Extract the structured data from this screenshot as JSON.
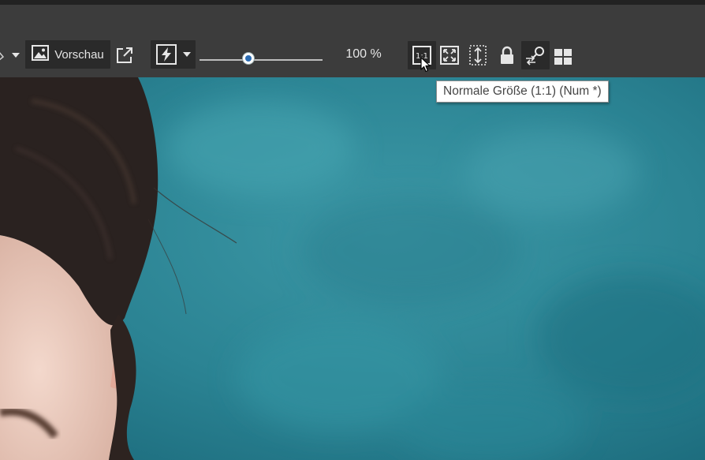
{
  "toolbar": {
    "preview_label": "Vorschau",
    "zoom_level": "100 %",
    "zoom_slider_value_percent": 40
  },
  "tooltip": {
    "text": "Normale Größe (1:1) (Num *)"
  },
  "icons": {
    "left_dropdown": "chevron-down-icon",
    "preview": "image-icon",
    "open_external": "external-link-icon",
    "quick_develop": "lightning-icon",
    "quick_develop_menu": "chevron-down-icon",
    "actual_size": "one-to-one-icon",
    "fit_window": "fit-window-icon",
    "fit_height": "fit-height-icon",
    "lock": "lock-icon",
    "compare": "compare-search-icon",
    "grid": "grid-icon"
  },
  "colors": {
    "toolbar_bg": "#3c3c3c",
    "button_bg": "#2a2a2a",
    "accent_thumb": "#2c6cb3",
    "photo_background": "#2f8a98"
  }
}
